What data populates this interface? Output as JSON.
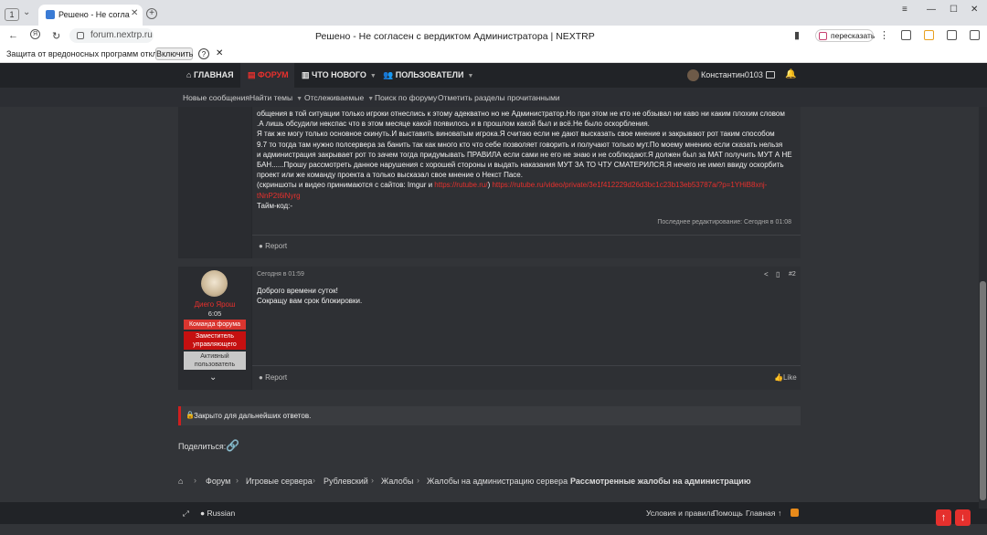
{
  "browser": {
    "tab_count": "1",
    "tab_title": "Решено - Не согласен с",
    "url": "forum.nextrp.ru",
    "page_title": "Решено - Не согласен с вердиктом Администратора | NEXTRP",
    "retell_label": "пересказать"
  },
  "warning": {
    "text": "Защита от вредоносных программ отключена",
    "enable_label": "Включить",
    "help": "?",
    "close": "✕"
  },
  "nav": {
    "home": "ГЛАВНАЯ",
    "forums": "ФОРУМ",
    "whats_new": "ЧТО НОВОГО",
    "members": "ПОЛЬЗОВАТЕЛИ",
    "username": "Константин0103"
  },
  "subnav": {
    "new_posts": "Новые сообщения",
    "find_threads": "Найти темы",
    "watched": "Отслеживаемые",
    "search": "Поиск по форуму",
    "mark_read": "Отметить разделы прочитанными"
  },
  "post1": {
    "lines": [
      "общения в той ситуации только игроки отнеслись к этому адекватно но не Администратор.Но при этом не кто не обзывал ни каво ни каким плохим словом",
      ".А лишь обсудили некспас что в этом месяце какой появилось и в прошлом какой был и всё.Не было оскорбления.",
      "Я так же могу только основное скинуть.И выставить виноватым игрока.Я считаю если не дают высказать свое мнение и закрывают рот таким способом",
      "9.7 то тогда там нужно полсервера за банить так как много кто что себе позволяет говорить и получают только мут.По моему мнению если сказать нельзя",
      "и администрация закрывает рот то зачем тогда придумывать ПРАВИЛА если сами не его не знаю и не соблюдают.Я должен был за МАТ получить МУТ А НЕ",
      "БАН......Прошу рассмотреть данное нарушения с хорошей стороны и выдать наказания МУТ ЗА ТО ЧТУ СМАТЕРИЛСЯ.Я нечего не имел ввиду оскорбить",
      "проект или же команду проекта а только высказал свое мнение о Некст Пасе."
    ],
    "evidence_prefix": "(скриншоты и видео принимаются с сайтов: Imgur и ",
    "link1": "https://rutube.ru/",
    "evidence_mid": ") ",
    "link2": "https://rutube.ru/video/private/3e1f412229d26d3bc1c23b13eb53787a/?p=1YHiB8xnj-",
    "link2b": "tNnP2t6iNyrg",
    "timecode": "Тайм-код:-",
    "edited": "Последнее редактирование: Сегодня в 01:08",
    "report": "Report"
  },
  "post2": {
    "username": "Диего Ярош",
    "user_time": "6:05",
    "badges": [
      "Команда форума",
      "Заместитель управляющего",
      "Активный пользователь"
    ],
    "date": "Сегодня в 01:59",
    "number": "#2",
    "lines": [
      "Доброго времени суток!",
      "Сокращу вам срок блокировки."
    ],
    "report": "Report",
    "like": "Like"
  },
  "closed": "Закрыто для дальнейших ответов.",
  "share_label": "Поделиться:",
  "breadcrumbs": [
    "Форум",
    "Игровые сервера",
    "Рублевский",
    "Жалобы",
    "Жалобы на администрацию сервера",
    "Рассмотренные жалобы на администрацию"
  ],
  "footer": {
    "language": "Russian",
    "terms": "Условия и правила",
    "help": "Помощь",
    "home": "Главная"
  },
  "colors": {
    "accent": "#e8302d",
    "bg": "#323438",
    "nav": "#212327"
  }
}
